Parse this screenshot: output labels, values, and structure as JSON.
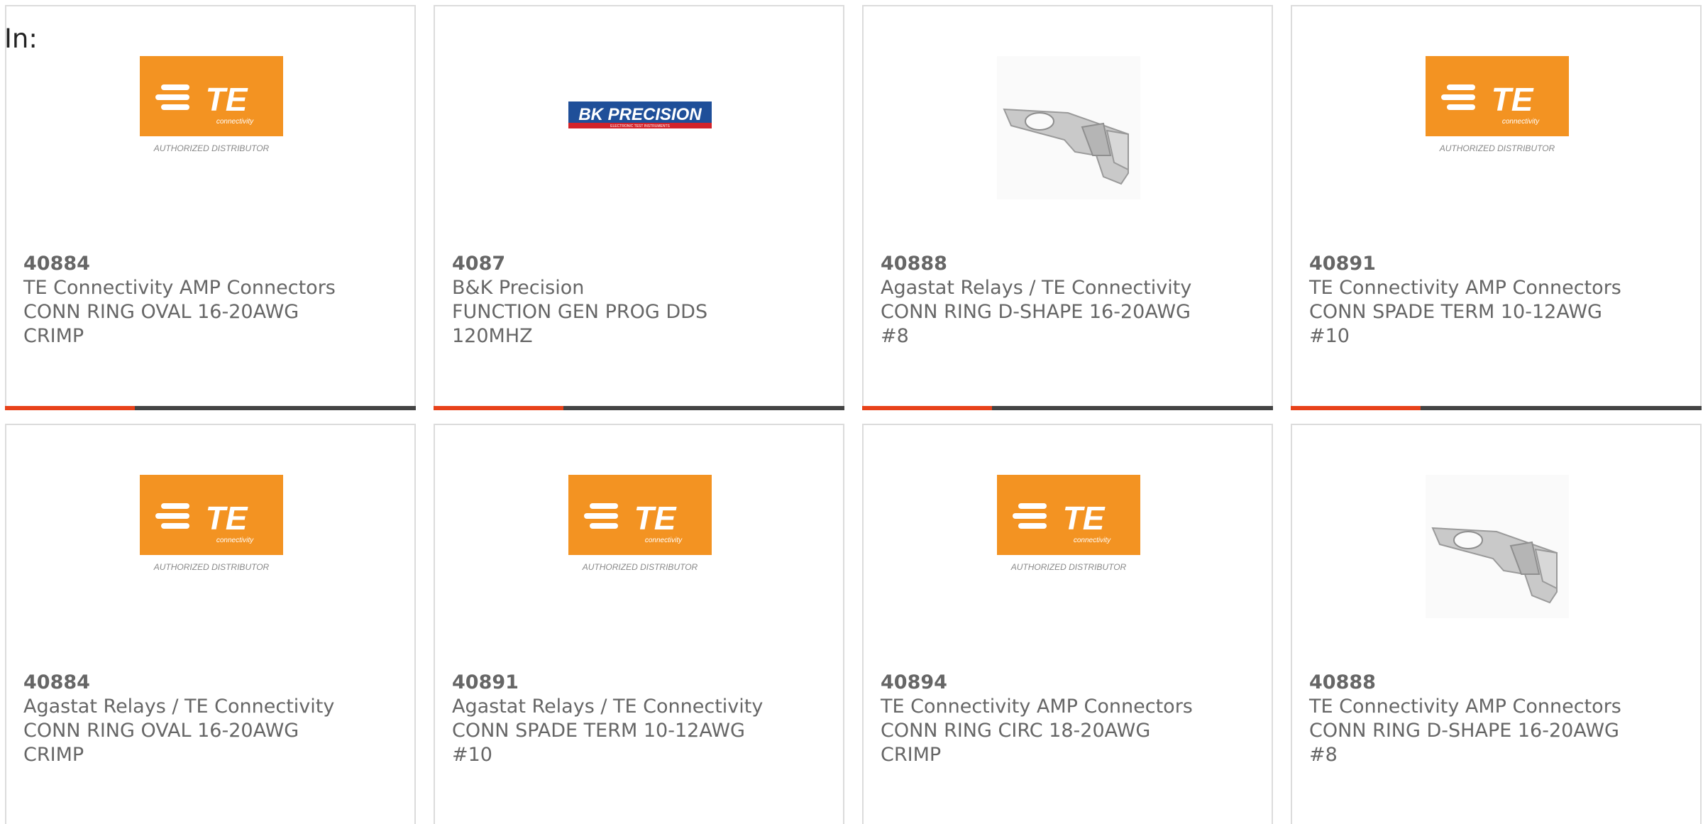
{
  "page": {
    "in_label": "In:"
  },
  "products": [
    {
      "part_number": "40884",
      "manufacturer": "TE Connectivity AMP Connectors",
      "desc_line1": "CONN RING OVAL 16-20AWG",
      "desc_line2": "CRIMP",
      "image": "te-logo",
      "logo_text": "TE",
      "logo_sub": "connectivity",
      "logo_caption": "AUTHORIZED DISTRIBUTOR"
    },
    {
      "part_number": "4087",
      "manufacturer": "B&K Precision",
      "desc_line1": "FUNCTION GEN PROG DDS",
      "desc_line2": "120MHZ",
      "image": "bk-precision-logo",
      "logo_text": "BK PRECISION",
      "logo_sub": "ELECTRONIC TEST INSTRUMENTS"
    },
    {
      "part_number": "40888",
      "manufacturer": "Agastat Relays / TE Connectivity",
      "desc_line1": "CONN RING D-SHAPE 16-20AWG",
      "desc_line2": "#8",
      "image": "ring-terminal-photo"
    },
    {
      "part_number": "40891",
      "manufacturer": "TE Connectivity AMP Connectors",
      "desc_line1": "CONN SPADE TERM 10-12AWG",
      "desc_line2": "#10",
      "image": "te-logo",
      "logo_text": "TE",
      "logo_sub": "connectivity",
      "logo_caption": "AUTHORIZED DISTRIBUTOR"
    },
    {
      "part_number": "40884",
      "manufacturer": "Agastat Relays / TE Connectivity",
      "desc_line1": "CONN RING OVAL 16-20AWG",
      "desc_line2": "CRIMP",
      "image": "te-logo",
      "logo_text": "TE",
      "logo_sub": "connectivity",
      "logo_caption": "AUTHORIZED DISTRIBUTOR"
    },
    {
      "part_number": "40891",
      "manufacturer": "Agastat Relays / TE Connectivity",
      "desc_line1": "CONN SPADE TERM 10-12AWG",
      "desc_line2": "#10",
      "image": "te-logo",
      "logo_text": "TE",
      "logo_sub": "connectivity",
      "logo_caption": "AUTHORIZED DISTRIBUTOR"
    },
    {
      "part_number": "40894",
      "manufacturer": "TE Connectivity AMP Connectors",
      "desc_line1": "CONN RING CIRC 18-20AWG",
      "desc_line2": "CRIMP",
      "image": "te-logo",
      "logo_text": "TE",
      "logo_sub": "connectivity",
      "logo_caption": "AUTHORIZED DISTRIBUTOR"
    },
    {
      "part_number": "40888",
      "manufacturer": "TE Connectivity AMP Connectors",
      "desc_line1": "CONN RING D-SHAPE 16-20AWG",
      "desc_line2": "#8",
      "image": "ring-terminal-photo"
    }
  ],
  "colors": {
    "accent": "#e8421a",
    "bar": "#444444",
    "te_orange": "#f39322",
    "bk_blue": "#1f4f99",
    "bk_red": "#d2232a",
    "text": "#666666"
  }
}
